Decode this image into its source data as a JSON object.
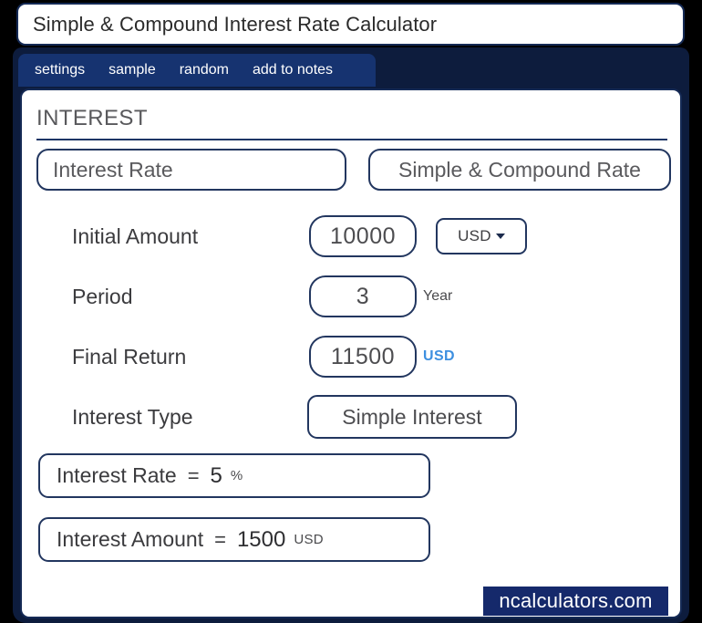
{
  "window": {
    "title": "Simple & Compound Interest Rate Calculator"
  },
  "tabs": [
    {
      "label": "settings"
    },
    {
      "label": "sample"
    },
    {
      "label": "random"
    },
    {
      "label": "add to notes"
    }
  ],
  "section": {
    "title": "INTEREST"
  },
  "mode_buttons": {
    "left_label": "Interest Rate",
    "right_label": "Simple & Compound Rate"
  },
  "form": {
    "initial_amount": {
      "label": "Initial Amount",
      "value": "10000",
      "currency": "USD",
      "caret": "chevron-down-icon"
    },
    "period": {
      "label": "Period",
      "value": "3",
      "unit": "Year"
    },
    "final_return": {
      "label": "Final Return",
      "value": "11500",
      "unit": "USD"
    },
    "interest_type": {
      "label": "Interest Type",
      "value": "Simple Interest"
    }
  },
  "results": [
    {
      "label": "Interest Rate",
      "equals": "=",
      "value": "5",
      "unit": "%"
    },
    {
      "label": "Interest Amount",
      "equals": "=",
      "value": "1500",
      "unit": "USD"
    }
  ],
  "footer": {
    "brand": "ncalculators.com"
  },
  "colors": {
    "navy_frame": "#0d1c3d",
    "navy_border": "#152a55",
    "tab_bar": "#163370",
    "brand_badge": "#15296b",
    "accent_blue": "#3d8fe0"
  }
}
